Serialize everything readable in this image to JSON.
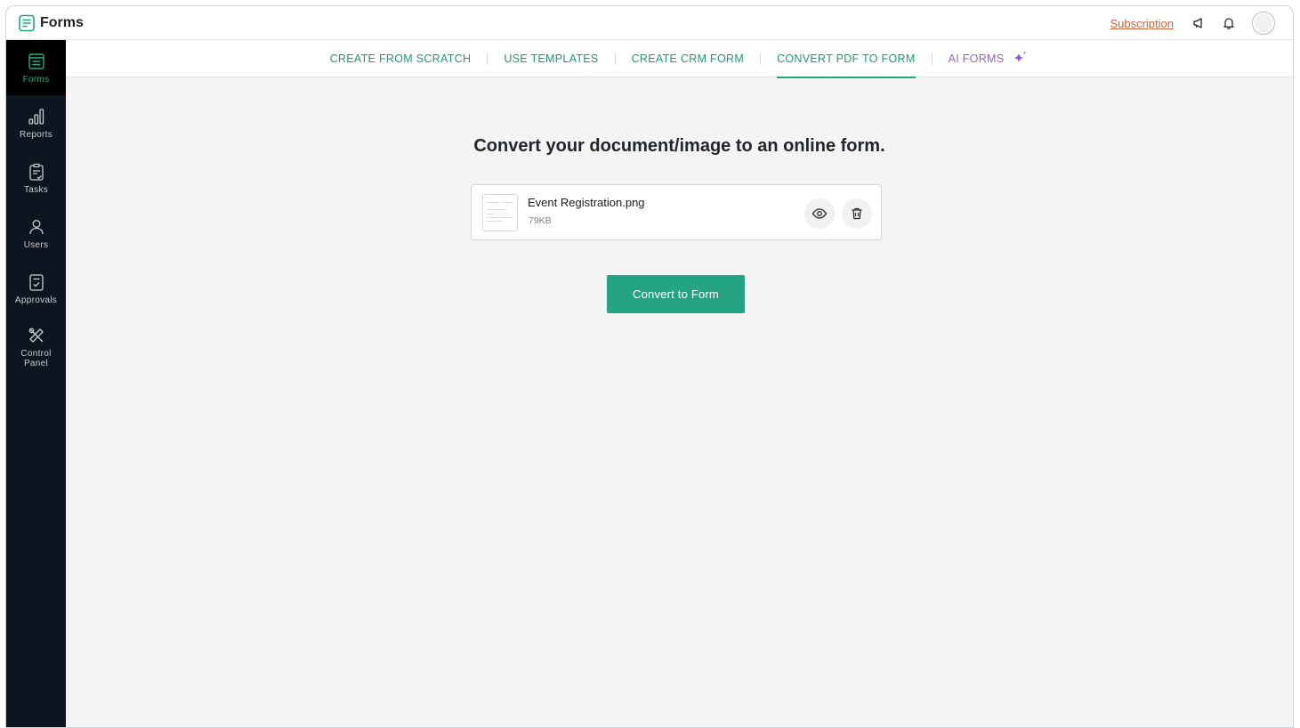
{
  "app": {
    "title": "Forms"
  },
  "topbar": {
    "subscription_label": "Subscription"
  },
  "sidebar": {
    "items": [
      {
        "label": "Forms",
        "icon": "forms-icon",
        "active": true
      },
      {
        "label": "Reports",
        "icon": "reports-icon"
      },
      {
        "label": "Tasks",
        "icon": "tasks-icon"
      },
      {
        "label": "Users",
        "icon": "user-icon"
      },
      {
        "label": "Approvals",
        "icon": "approvals-icon"
      },
      {
        "label": "Control Panel",
        "icon": "tools-icon"
      }
    ]
  },
  "tabs": [
    {
      "label": "CREATE FROM SCRATCH"
    },
    {
      "label": "USE TEMPLATES"
    },
    {
      "label": "CREATE CRM FORM"
    },
    {
      "label": "CONVERT PDF TO FORM",
      "active": true
    },
    {
      "label": "AI FORMS",
      "icon": "sparkle-icon"
    }
  ],
  "main": {
    "heading": "Convert your document/image to an online form.",
    "file": {
      "name": "Event Registration.png",
      "size": "79KB"
    },
    "convert_label": "Convert to Form"
  },
  "colors": {
    "accent": "#24a482",
    "sidebar_bg": "#0b1620",
    "ai_purple": "#9066c7",
    "link_orange": "#c7673a"
  }
}
